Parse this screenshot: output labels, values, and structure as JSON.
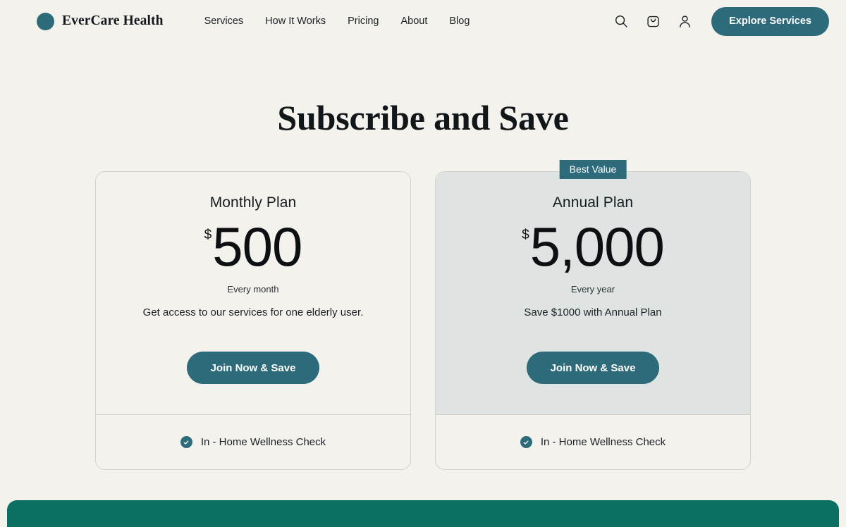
{
  "header": {
    "brand": {
      "name": "EverCare Health",
      "mark_color": "#2d6a7a"
    },
    "nav": [
      {
        "label": "Services"
      },
      {
        "label": "How It Works"
      },
      {
        "label": "Pricing"
      },
      {
        "label": "About"
      },
      {
        "label": "Blog"
      }
    ],
    "icons": [
      {
        "name": "search-icon"
      },
      {
        "name": "shopping-bag-icon"
      },
      {
        "name": "account-icon"
      }
    ],
    "cta": {
      "label": "Explore Services",
      "color": "#2d6a7a"
    }
  },
  "main": {
    "title": "Subscribe and Save",
    "plans": [
      {
        "name": "Monthly Plan",
        "badge": null,
        "currency": "$",
        "price": "500",
        "period": "Every month",
        "description": "Get access to our services for one elderly user.",
        "cta_label": "Join Now & Save",
        "features": [
          {
            "label": "In - Home Wellness Check"
          }
        ]
      },
      {
        "name": "Annual Plan",
        "badge": "Best Value",
        "currency": "$",
        "price": "5,000",
        "period": "Every year",
        "description": "Save $1000 with Annual Plan",
        "cta_label": "Join Now & Save",
        "features": [
          {
            "label": "In - Home Wellness Check"
          }
        ]
      }
    ]
  },
  "colors": {
    "page_background": "#f4f2ed",
    "accent_teal": "#2d6a7a",
    "featured_card": "#dfe3e2",
    "footer_band": "#0a7162"
  }
}
